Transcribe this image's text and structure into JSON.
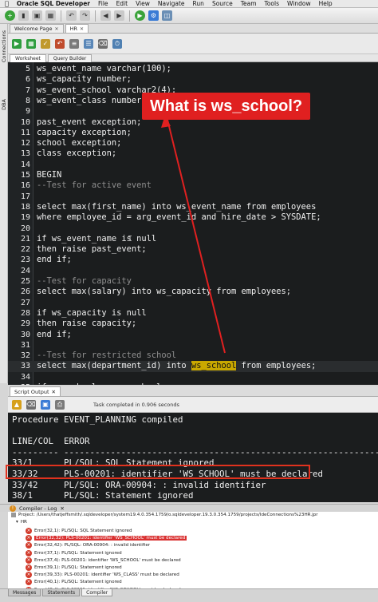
{
  "menubar": {
    "apple": "",
    "app_name": "Oracle SQL Developer",
    "items": [
      "File",
      "Edit",
      "View",
      "Navigate",
      "Run",
      "Source",
      "Team",
      "Tools",
      "Window",
      "Help"
    ]
  },
  "side_tabs": [
    "Connections",
    "DBA"
  ],
  "doc_tabs": [
    {
      "label": "Welcome Page",
      "active": false
    },
    {
      "label": "HR",
      "active": true
    }
  ],
  "editor_subtabs": [
    "Worksheet",
    "Query Builder"
  ],
  "editor": {
    "lines": [
      {
        "n": "5",
        "code": "ws_event_name varchar(100);"
      },
      {
        "n": "6",
        "code": "ws_capacity number;"
      },
      {
        "n": "7",
        "code": "ws_event_school varchar2(4);"
      },
      {
        "n": "8",
        "code": "ws_event_class number;"
      },
      {
        "n": "9",
        "code": ""
      },
      {
        "n": "10",
        "code": "past_event exception;"
      },
      {
        "n": "11",
        "code": "capacity exception;"
      },
      {
        "n": "12",
        "code": "school exception;"
      },
      {
        "n": "13",
        "code": "class exception;"
      },
      {
        "n": "14",
        "code": ""
      },
      {
        "n": "15",
        "code": "BEGIN"
      },
      {
        "n": "16",
        "code": "--Test for active event"
      },
      {
        "n": "17",
        "code": ""
      },
      {
        "n": "18",
        "code": "select max(first_name) into ws_event_name from employees"
      },
      {
        "n": "19",
        "code": "where employee_id = arg_event_id and hire_date > SYSDATE;"
      },
      {
        "n": "20",
        "code": ""
      },
      {
        "n": "21",
        "code": "if ws_event_name is null"
      },
      {
        "n": "22",
        "code": "then raise past_event;"
      },
      {
        "n": "23",
        "code": "end if;"
      },
      {
        "n": "24",
        "code": ""
      },
      {
        "n": "25",
        "code": "--Test for capacity"
      },
      {
        "n": "26",
        "code": "select max(salary) into ws_capacity from employees;"
      },
      {
        "n": "27",
        "code": ""
      },
      {
        "n": "28",
        "code": "if ws_capacity is null"
      },
      {
        "n": "29",
        "code": "then raise capacity;"
      },
      {
        "n": "30",
        "code": "end if;"
      },
      {
        "n": "31",
        "code": ""
      },
      {
        "n": "32",
        "code": "--Test for restricted school"
      },
      {
        "n": "33",
        "code_pre": "select max(department_id) into ",
        "code_hl": "ws_school",
        "code_post": " from employees;"
      },
      {
        "n": "34",
        "code": ""
      },
      {
        "n": "35",
        "code": "if ws_school = arg_school"
      }
    ]
  },
  "annotation": {
    "callout": "What is ws_school?",
    "color": "#e02020"
  },
  "script_output": {
    "tab_label": "Script Output",
    "status": "Task completed in 0.906 seconds",
    "lines": [
      "Procedure EVENT_PLANNING compiled",
      "",
      "LINE/COL  ERROR",
      "--------- -------------------------------------------------------------",
      "33/1      PL/SQL: SQL Statement ignored",
      "33/32     PLS-00201: identifier 'WS_SCHOOL' must be declared",
      "33/42     PL/SQL: ORA-00904: : invalid identifier",
      "38/1      PL/SQL: Statement ignored"
    ]
  },
  "compiler_log": {
    "title": "Compiler - Log",
    "project": "Project: /Users/thatjeffsmith/.sqldeveloper/system19.4.0.354.1759/o.sqldeveloper.19.3.0.354.1759/projects/IdeConnections%23HR.jpr",
    "node": "HR",
    "entries": [
      {
        "text": "Error(32,1): PL/SQL: SQL Statement ignored",
        "selected": false
      },
      {
        "text": "Error(32,32): PLS-00201: identifier 'WS_SCHOOL' must be declared",
        "selected": true
      },
      {
        "text": "Error(32,42): PL/SQL: ORA-00904: : invalid identifier",
        "selected": false
      },
      {
        "text": "Error(37,1): PL/SQL: Statement ignored",
        "selected": false
      },
      {
        "text": "Error(37,4): PLS-00201: identifier 'WS_SCHOOL' must be declared",
        "selected": false
      },
      {
        "text": "Error(39,1): PL/SQL: Statement ignored",
        "selected": false
      },
      {
        "text": "Error(39,33): PLS-00201: identifier 'WS_CLASS' must be declared",
        "selected": false
      },
      {
        "text": "Error(40,1): PL/SQL: Statement ignored",
        "selected": false
      },
      {
        "text": "Error(40,4): PLS-00201: identifier 'WS_SCHOOL' must be declared",
        "selected": false
      }
    ]
  },
  "bottom_tabs": [
    "Messages",
    "Statements",
    "Compiler"
  ]
}
